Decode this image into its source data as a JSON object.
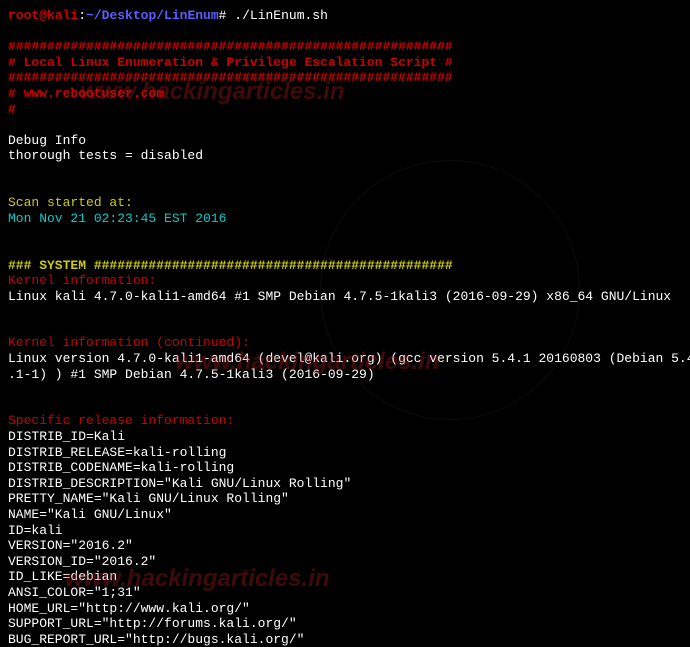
{
  "watermark": "www.hackingarticles.in",
  "prompt": {
    "user": "root@kali",
    "sep1": ":",
    "tilde": "~",
    "path": "/Desktop/LinEnum",
    "end": "#",
    "command": "./LinEnum.sh"
  },
  "banner": {
    "line1": "#########################################################",
    "line2": "# Local Linux Enumeration & Privilege Escalation Script #",
    "line3": "#########################################################",
    "line4": "# www.rebootuser.com",
    "line5": "#"
  },
  "debug": {
    "title": "Debug Info",
    "thorough": "thorough tests = disabled"
  },
  "scan": {
    "label": "Scan started at:",
    "time": "Mon Nov 21 02:23:45 EST 2016"
  },
  "system": {
    "header": "### SYSTEM ##############################################",
    "kernel_label": "Kernel information:",
    "kernel_info": "Linux kali 4.7.0-kali1-amd64 #1 SMP Debian 4.7.5-1kali3 (2016-09-29) x86_64 GNU/Linux",
    "kernel_cont_label": "Kernel information (continued):",
    "kernel_cont_line1": "Linux version 4.7.0-kali1-amd64 (devel@kali.org) (gcc version 5.4.1 20160803 (Debian 5.4",
    "kernel_cont_line2": ".1-1) ) #1 SMP Debian 4.7.5-1kali3 (2016-09-29)",
    "release_label": "Specific release information:",
    "release": [
      "DISTRIB_ID=Kali",
      "DISTRIB_RELEASE=kali-rolling",
      "DISTRIB_CODENAME=kali-rolling",
      "DISTRIB_DESCRIPTION=\"Kali GNU/Linux Rolling\"",
      "PRETTY_NAME=\"Kali GNU/Linux Rolling\"",
      "NAME=\"Kali GNU/Linux\"",
      "ID=kali",
      "VERSION=\"2016.2\"",
      "VERSION_ID=\"2016.2\"",
      "ID_LIKE=debian",
      "ANSI_COLOR=\"1;31\"",
      "HOME_URL=\"http://www.kali.org/\"",
      "SUPPORT_URL=\"http://forums.kali.org/\"",
      "BUG_REPORT_URL=\"http://bugs.kali.org/\""
    ]
  }
}
